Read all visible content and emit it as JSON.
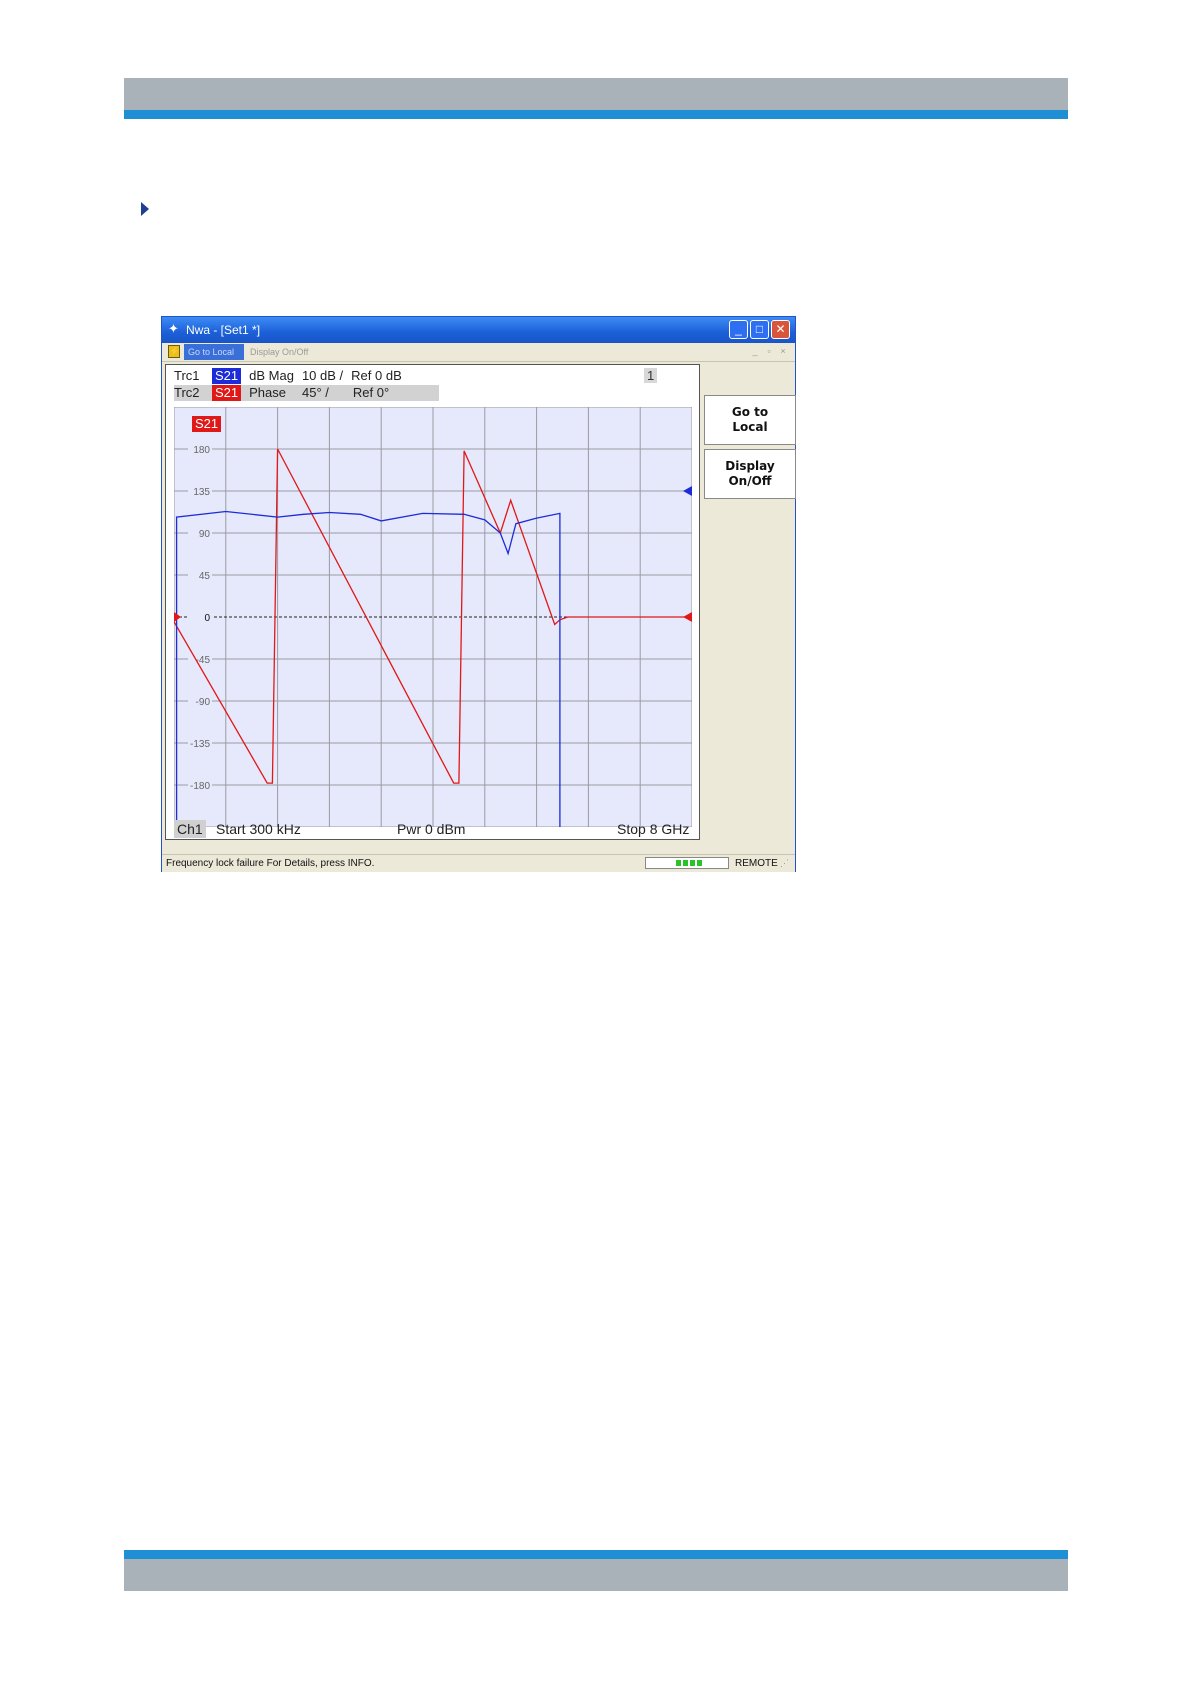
{
  "window": {
    "title": "Nwa - [Set1 *]",
    "controls": {
      "minimize": "_",
      "maximize": "□",
      "close": "✕"
    }
  },
  "toolbar": {
    "go_to_local": "Go to Local",
    "display_on_off": "Display On/Off",
    "mdi_controls": [
      "_",
      "▫",
      "×"
    ]
  },
  "traces": [
    {
      "name": "Trc1",
      "param": "S21",
      "format": "dB Mag",
      "scale": "10 dB /",
      "ref": "Ref 0 dB",
      "color": "#1c2cd8"
    },
    {
      "name": "Trc2",
      "param": "S21",
      "format": "Phase",
      "scale": "45° /",
      "ref": "Ref 0°",
      "color": "#e01818"
    }
  ],
  "channel_number": "1",
  "diagram_badge": "S21",
  "channel": {
    "label": "Ch1",
    "start": "Start 300 kHz",
    "power": "Pwr 0 dBm",
    "stop": "Stop 8 GHz"
  },
  "softkeys": [
    {
      "label": "Go to\nLocal"
    },
    {
      "label": "Display\nOn/Off"
    }
  ],
  "status_bar": {
    "message": "Frequency lock failure For Details, press INFO.",
    "mode": "REMOTE"
  },
  "chart_data": {
    "type": "line",
    "xlim": [
      0,
      10
    ],
    "ylim": [
      -225,
      225
    ],
    "y_ticks": [
      180,
      135,
      90,
      45,
      0,
      -45,
      -90,
      -135,
      -180
    ],
    "y_tick_labels": [
      "180",
      "135",
      "90",
      "45",
      "0",
      "-45",
      "-90",
      "-135",
      "-180"
    ],
    "grid": true,
    "series": [
      {
        "name": "S21",
        "color": "#e01818",
        "x": [
          0.0,
          1.8,
          1.9,
          2.0,
          5.4,
          5.5,
          5.6,
          6.3,
          6.5,
          7.35,
          7.45,
          7.6,
          10.0
        ],
        "y": [
          -5,
          -178,
          -178,
          180,
          -178,
          -178,
          178,
          90,
          125,
          -8,
          -3,
          0,
          0
        ]
      },
      {
        "name": "S21",
        "color": "#1c2cd8",
        "x": [
          0.05,
          0.05,
          1.0,
          2.0,
          2.5,
          3.0,
          3.6,
          4.0,
          4.8,
          5.6,
          6.0,
          6.3,
          6.45,
          6.6,
          7.0,
          7.45,
          7.45
        ],
        "y": [
          -225,
          107,
          113,
          107,
          110,
          112,
          110,
          103,
          111,
          110,
          104,
          90,
          68,
          100,
          106,
          111,
          -225
        ]
      }
    ],
    "markers": [
      {
        "side": "right",
        "color": "#1c2cd8",
        "y": 135
      },
      {
        "side": "right",
        "color": "#e01818",
        "y": 0
      },
      {
        "side": "left",
        "color": "#e01818",
        "y": 0
      }
    ]
  }
}
